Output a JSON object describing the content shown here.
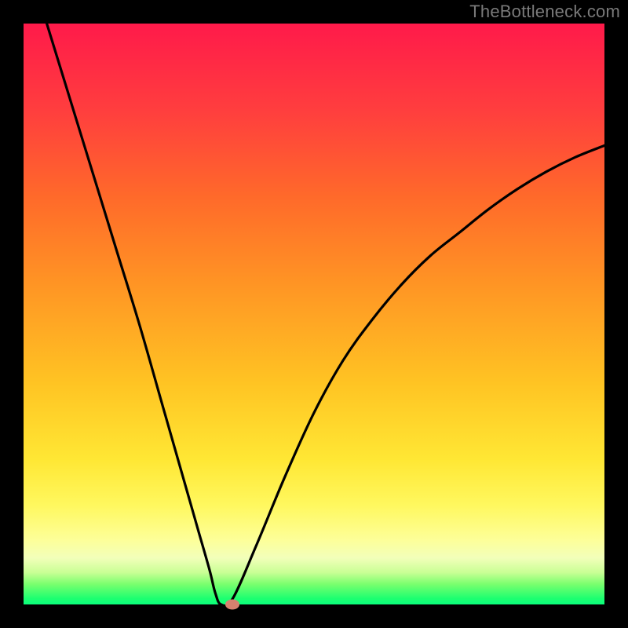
{
  "watermark": "TheBottleneck.com",
  "colors": {
    "frame": "#000000",
    "curve": "#000000",
    "marker": "#d7816f",
    "gradient_top": "#ff1a4a",
    "gradient_bottom": "#0aff7c"
  },
  "chart_data": {
    "type": "line",
    "title": "",
    "xlabel": "",
    "ylabel": "",
    "x_range": [
      0,
      100
    ],
    "y_range": [
      0,
      100
    ],
    "minimum_point": {
      "x": 34,
      "y": 0
    },
    "marker": {
      "x": 36,
      "y": 0
    },
    "series": [
      {
        "name": "bottleneck-curve",
        "x": [
          4,
          8,
          12,
          16,
          20,
          24,
          28,
          30,
          32,
          33,
          34,
          36,
          40,
          45,
          50,
          55,
          60,
          65,
          70,
          75,
          80,
          85,
          90,
          95,
          100
        ],
        "y": [
          100,
          87,
          74,
          61,
          48,
          34,
          20,
          13,
          6,
          2,
          0,
          1,
          10,
          22,
          33,
          42,
          49,
          55,
          60,
          64,
          68,
          71.5,
          74.5,
          77,
          79
        ]
      }
    ],
    "annotations": []
  }
}
